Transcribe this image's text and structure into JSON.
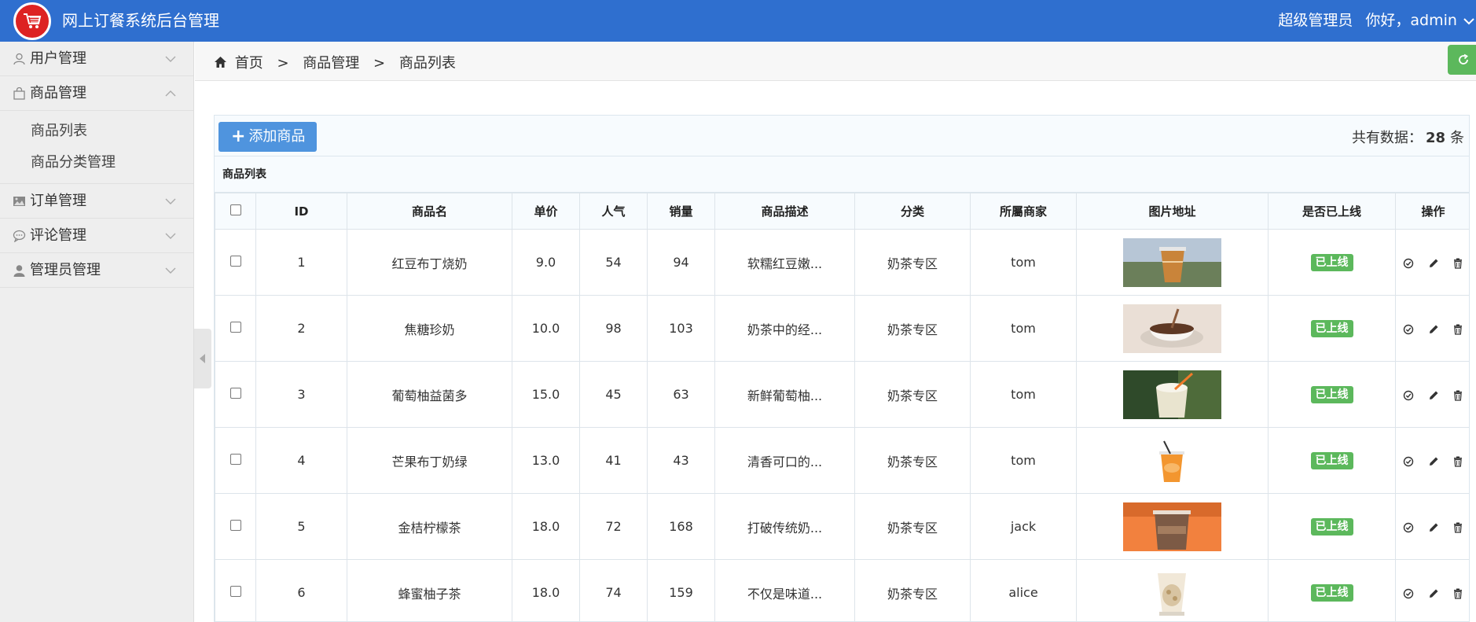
{
  "header": {
    "title": "网上订餐系统后台管理",
    "role": "超级管理员",
    "greeting": "你好，admin"
  },
  "sidebar": {
    "items": [
      {
        "label": "用户管理",
        "icon": "user-icon",
        "expanded": false
      },
      {
        "label": "商品管理",
        "icon": "bag-icon",
        "expanded": true,
        "children": [
          {
            "label": "商品列表"
          },
          {
            "label": "商品分类管理"
          }
        ]
      },
      {
        "label": "订单管理",
        "icon": "image-icon",
        "expanded": false
      },
      {
        "label": "评论管理",
        "icon": "comment-icon",
        "expanded": false
      },
      {
        "label": "管理员管理",
        "icon": "admin-icon",
        "expanded": false
      }
    ]
  },
  "breadcrumb": {
    "home": "首页",
    "section": "商品管理",
    "page": "商品列表"
  },
  "toolbar": {
    "add_label": "添加商品",
    "total_prefix": "共有数据：",
    "total_count": "28",
    "total_suffix": "条"
  },
  "list": {
    "caption": "商品列表",
    "columns": [
      "ID",
      "商品名",
      "单价",
      "人气",
      "销量",
      "商品描述",
      "分类",
      "所屬商家",
      "图片地址",
      "是否已上线",
      "操作"
    ],
    "rows": [
      {
        "id": "1",
        "name": "红豆布丁烧奶",
        "price": "9.0",
        "popularity": "54",
        "sales": "94",
        "desc": "软糯红豆嫩...",
        "category": "奶茶专区",
        "merchant": "tom",
        "image": "milk-tea-cup-photo",
        "status": "已上线"
      },
      {
        "id": "2",
        "name": "焦糖珍奶",
        "price": "10.0",
        "popularity": "98",
        "sales": "103",
        "desc": "奶茶中的经...",
        "category": "奶茶专区",
        "merchant": "tom",
        "image": "caramel-coffee-photo",
        "status": "已上线"
      },
      {
        "id": "3",
        "name": "葡萄柚益菌多",
        "price": "15.0",
        "popularity": "45",
        "sales": "63",
        "desc": "新鲜葡萄柚...",
        "category": "奶茶专区",
        "merchant": "tom",
        "image": "grapefruit-drink-photo",
        "status": "已上线"
      },
      {
        "id": "4",
        "name": "芒果布丁奶绿",
        "price": "13.0",
        "popularity": "41",
        "sales": "43",
        "desc": "清香可口的...",
        "category": "奶茶专区",
        "merchant": "tom",
        "image": "mango-drink-photo",
        "status": "已上线"
      },
      {
        "id": "5",
        "name": "金桔柠檬茶",
        "price": "18.0",
        "popularity": "72",
        "sales": "168",
        "desc": "打破传统奶...",
        "category": "奶茶专区",
        "merchant": "jack",
        "image": "kumquat-tea-photo",
        "status": "已上线"
      },
      {
        "id": "6",
        "name": "蜂蜜柚子茶",
        "price": "18.0",
        "popularity": "74",
        "sales": "159",
        "desc": "不仅是味道...",
        "category": "奶茶专区",
        "merchant": "alice",
        "image": "honey-citron-photo",
        "status": "已上线"
      }
    ]
  },
  "colors": {
    "header": "#2f6fcf",
    "add_button": "#4f94de",
    "online_badge": "#5cb85c",
    "refresh_button": "#5cb85c"
  }
}
